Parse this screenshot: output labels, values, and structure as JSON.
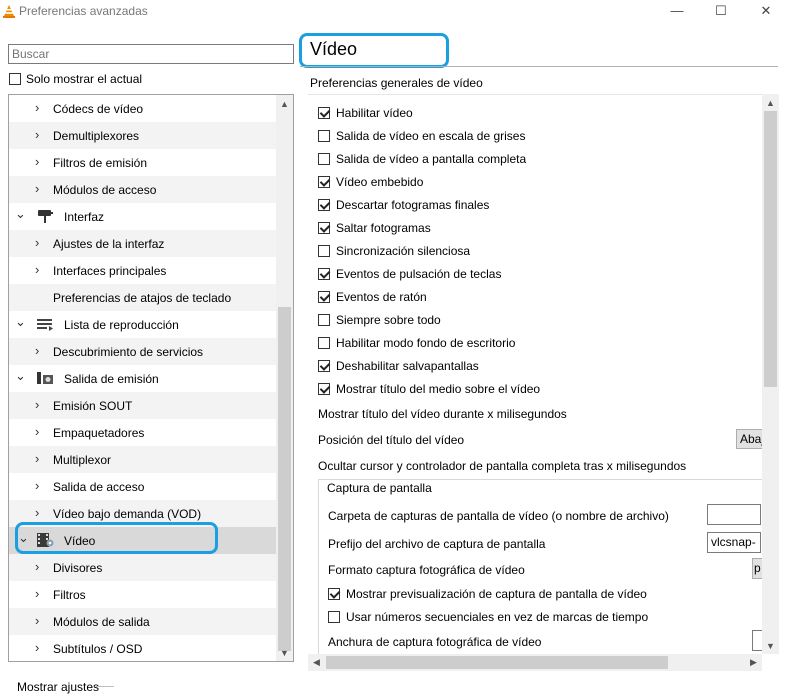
{
  "window": {
    "title": "Preferencias avanzadas",
    "min_glyph": "—",
    "max_glyph": "☐",
    "close_glyph": "✕"
  },
  "search": {
    "placeholder": "Buscar"
  },
  "only_current": {
    "label": "Solo mostrar el actual",
    "checked": false
  },
  "tree": {
    "items": [
      {
        "label": "Códecs de vídeo",
        "expander": "›",
        "level": "child"
      },
      {
        "label": "Demultiplexores",
        "expander": "›",
        "level": "child"
      },
      {
        "label": "Filtros de emisión",
        "expander": "›",
        "level": "child"
      },
      {
        "label": "Módulos de acceso",
        "expander": "›",
        "level": "child"
      },
      {
        "label": "Interfaz",
        "expander": "⌄",
        "level": "category",
        "icon": "paint-roller-icon"
      },
      {
        "label": "Ajustes de la interfaz",
        "expander": "›",
        "level": "child"
      },
      {
        "label": "Interfaces principales",
        "expander": "›",
        "level": "child"
      },
      {
        "label": "Preferencias de atajos de teclado",
        "expander": "",
        "level": "child"
      },
      {
        "label": "Lista de reproducción",
        "expander": "⌄",
        "level": "category",
        "icon": "playlist-icon"
      },
      {
        "label": "Descubrimiento de servicios",
        "expander": "›",
        "level": "child"
      },
      {
        "label": "Salida de emisión",
        "expander": "⌄",
        "level": "category",
        "icon": "stream-output-icon"
      },
      {
        "label": "Emisión SOUT",
        "expander": "›",
        "level": "child"
      },
      {
        "label": "Empaquetadores",
        "expander": "›",
        "level": "child"
      },
      {
        "label": "Multiplexor",
        "expander": "›",
        "level": "child"
      },
      {
        "label": "Salida de acceso",
        "expander": "›",
        "level": "child"
      },
      {
        "label": "Vídeo bajo demanda (VOD)",
        "expander": "›",
        "level": "child"
      },
      {
        "label": "Vídeo",
        "expander": "⌄",
        "level": "category",
        "icon": "video-film-icon",
        "selected": true
      },
      {
        "label": "Divisores",
        "expander": "›",
        "level": "child"
      },
      {
        "label": "Filtros",
        "expander": "›",
        "level": "child"
      },
      {
        "label": "Módulos de salida",
        "expander": "›",
        "level": "child"
      },
      {
        "label": "Subtítulos / OSD",
        "expander": "›",
        "level": "child"
      }
    ]
  },
  "panel": {
    "title": "Vídeo",
    "section": "Preferencias generales de vídeo",
    "checkboxes": [
      {
        "label": "Habilitar vídeo",
        "checked": true
      },
      {
        "label": "Salida de vídeo en escala de grises",
        "checked": false
      },
      {
        "label": "Salida de vídeo a pantalla completa",
        "checked": false
      },
      {
        "label": "Vídeo embebido",
        "checked": true
      },
      {
        "label": "Descartar fotogramas finales",
        "checked": true
      },
      {
        "label": "Saltar fotogramas",
        "checked": true
      },
      {
        "label": "Sincronización silenciosa",
        "checked": false
      },
      {
        "label": "Eventos de pulsación de teclas",
        "checked": true
      },
      {
        "label": "Eventos de ratón",
        "checked": true
      },
      {
        "label": "Siempre sobre todo",
        "checked": false
      },
      {
        "label": "Habilitar modo fondo de escritorio",
        "checked": false
      },
      {
        "label": "Deshabilitar salvapantallas",
        "checked": true
      },
      {
        "label": "Mostrar título del medio sobre el vídeo",
        "checked": true
      }
    ],
    "title_duration_label": "Mostrar título del vídeo durante x milisegundos",
    "title_position_label": "Posición del título del vídeo",
    "title_position_value": "Abaj",
    "hide_cursor_label": "Ocultar cursor y controlador de pantalla completa tras x milisegundos",
    "snapshot": {
      "group_title": "Captura de pantalla",
      "folder_label": "Carpeta de capturas de pantalla de vídeo (o nombre de archivo)",
      "folder_value": "",
      "prefix_label": "Prefijo del archivo de captura de pantalla",
      "prefix_value": "vlcsnap-",
      "format_label": "Formato captura fotográfica de vídeo",
      "format_value": "p",
      "preview_label": "Mostrar previsualización de captura de pantalla de vídeo",
      "preview_checked": true,
      "sequential_label": "Usar números secuenciales en vez de marcas de tiempo",
      "sequential_checked": false,
      "width_label": "Anchura de captura fotográfica de vídeo"
    }
  },
  "scroll_arrows": {
    "up": "▲",
    "down": "▼",
    "left": "◀",
    "right": "▶"
  },
  "footer": {
    "show_settings_label": "Mostrar ajustes"
  },
  "colors": {
    "highlight": "#1aa0e0",
    "selected_row": "#d9d9d9",
    "alt_row": "#f3f3f3"
  }
}
